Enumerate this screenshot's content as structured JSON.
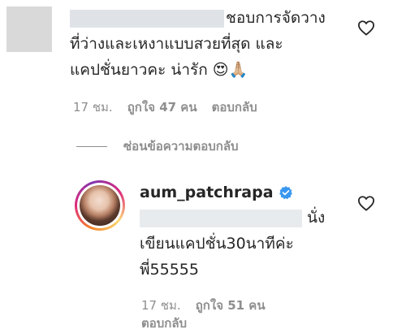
{
  "comment": {
    "text_line1": "ชอบการจัดวาง",
    "text_line2": "ที่ว่างและเหงาแบบสวยที่สุด และ",
    "text_line3": "แคปชั่นยาวคะ น่ารัก 😍🙏🏼",
    "time": "17 ชม.",
    "likes": "ถูกใจ 47 คน",
    "reply_label": "ตอบกลับ"
  },
  "hide_replies_label": "ซ่อนข้อความตอบกลับ",
  "reply": {
    "username": "aum_patchrapa",
    "text_line1": "นั่ง",
    "text_line2": "เขียนแคปชั่น30นาทีค่ะ",
    "text_line3": "พี่55555",
    "time": "17 ชม.",
    "likes": "ถูกใจ 51 คน",
    "reply_label": "ตอบกลับ"
  },
  "icons": {
    "like": "heart-outline-icon",
    "verified": "verified-badge-icon"
  },
  "colors": {
    "text": "#262626",
    "meta": "#8e8e8e",
    "verified_blue": "#3897f0"
  }
}
